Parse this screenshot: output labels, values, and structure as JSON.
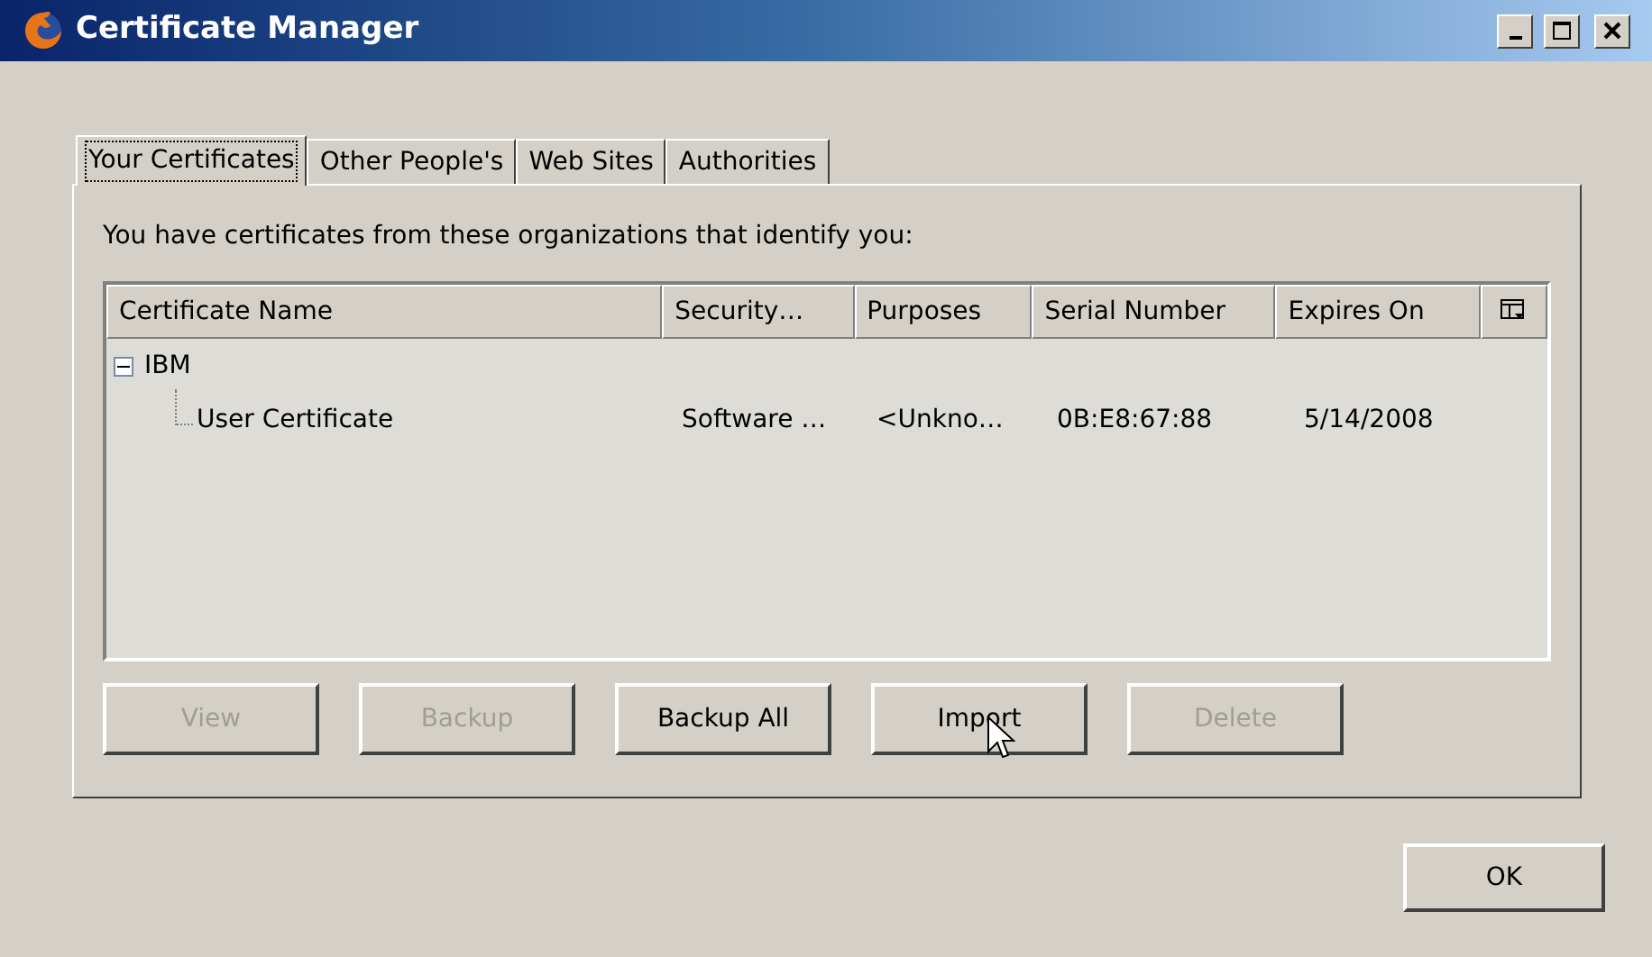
{
  "window": {
    "title": "Certificate Manager"
  },
  "tabs": [
    {
      "label": "Your Certificates",
      "selected": true
    },
    {
      "label": "Other People's",
      "selected": false
    },
    {
      "label": "Web Sites",
      "selected": false
    },
    {
      "label": "Authorities",
      "selected": false
    }
  ],
  "intro": "You have certificates from these organizations that identify you:",
  "tree": {
    "columns": [
      "Certificate Name",
      "Security…",
      "Purposes",
      "Serial Number",
      "Expires On"
    ],
    "rows": [
      {
        "cells": [
          "IBM"
        ],
        "expanded": true,
        "children": [
          {
            "cells": [
              "User Certificate",
              "Software …",
              "<Unkno…",
              "0B:E8:67:88",
              "5/14/2008"
            ]
          }
        ]
      }
    ]
  },
  "buttons": [
    {
      "label": "View",
      "disabled": true
    },
    {
      "label": "Backup",
      "disabled": true
    },
    {
      "label": "Backup All",
      "disabled": false
    },
    {
      "label": "Import",
      "disabled": false
    },
    {
      "label": "Delete",
      "disabled": true
    }
  ],
  "ok_button": "OK"
}
